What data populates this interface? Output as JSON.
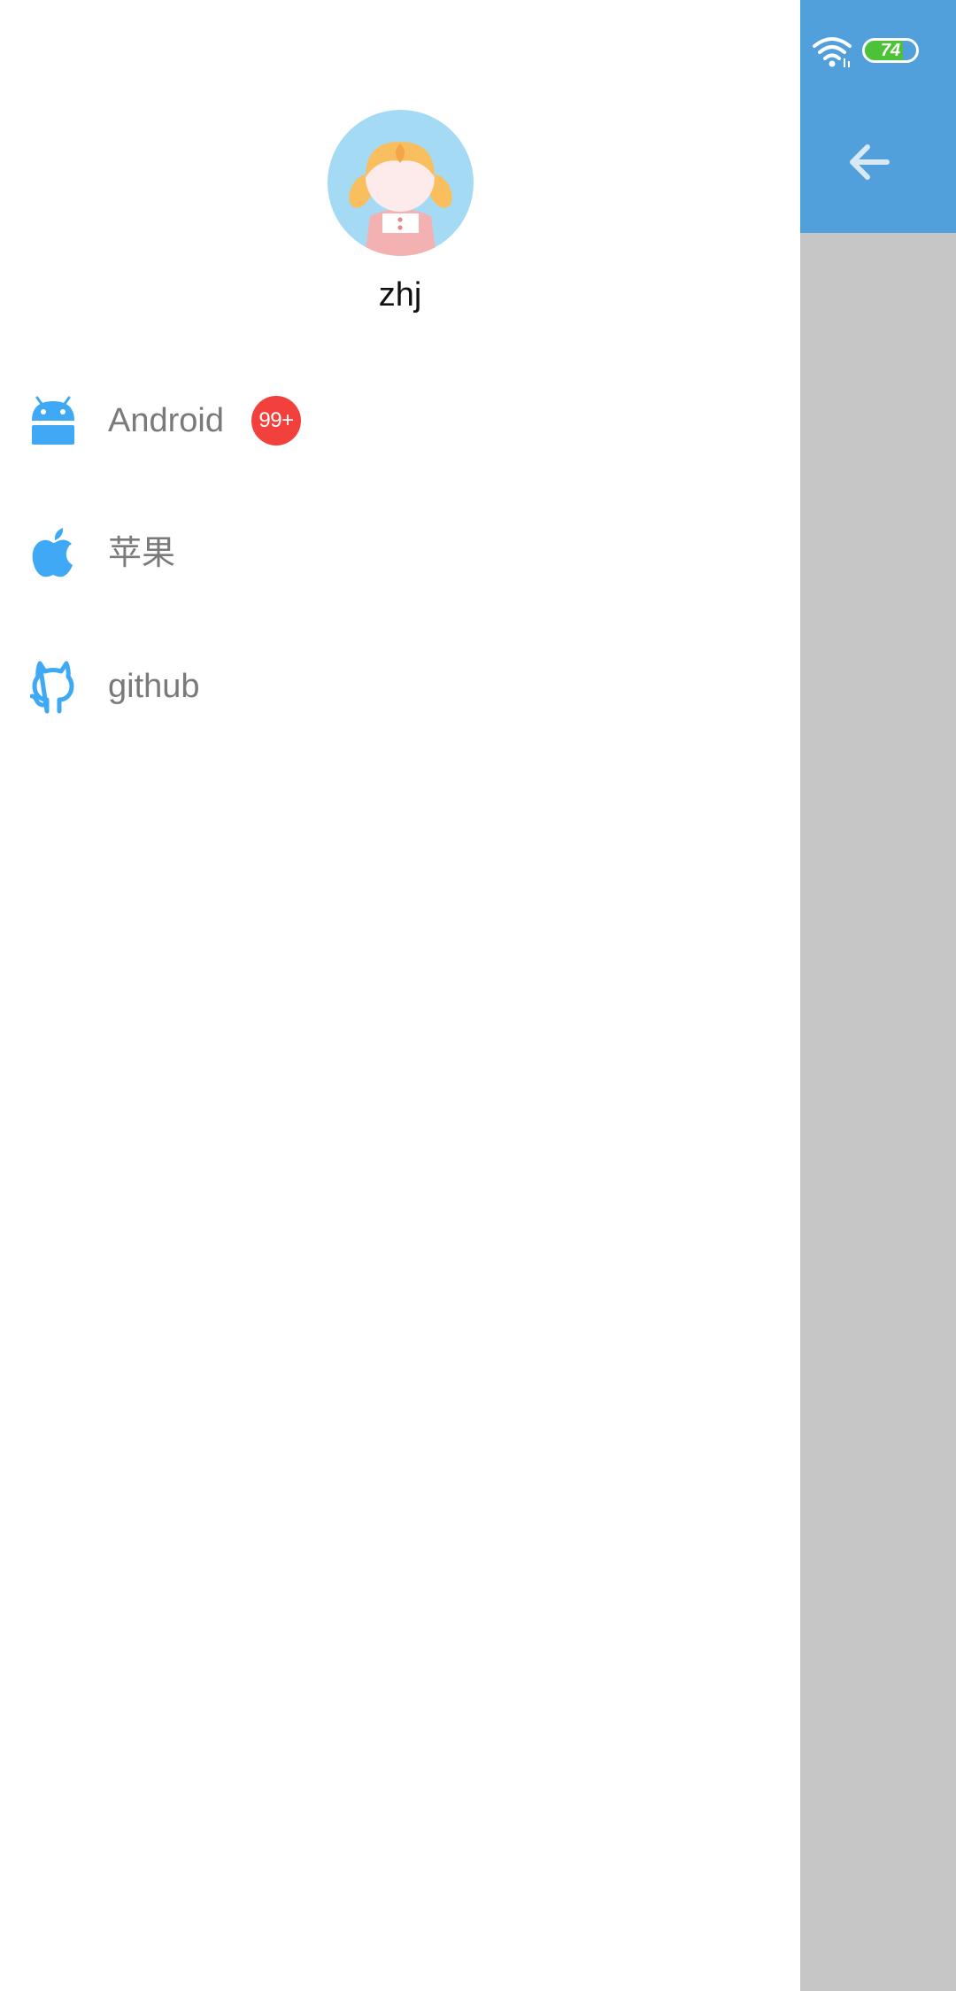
{
  "status_bar": {
    "battery_level": "74",
    "battery_fraction": 0.74,
    "wifi_icon": "wifi-icon",
    "colors": {
      "header": "#519fdb",
      "battery_fill": "#4cc238"
    }
  },
  "underlay": {
    "back_icon": "arrow-left-icon"
  },
  "drawer": {
    "profile": {
      "avatar_icon": "girl-avatar",
      "username": "zhj"
    },
    "menu": [
      {
        "label": "Android",
        "icon": "android-icon",
        "badge": "99+"
      },
      {
        "label": "苹果",
        "icon": "apple-icon"
      },
      {
        "label": "github",
        "icon": "github-icon"
      }
    ],
    "colors": {
      "icon": "#3fa9f5",
      "badge": "#f2403d",
      "label": "#7a7a7a"
    }
  }
}
